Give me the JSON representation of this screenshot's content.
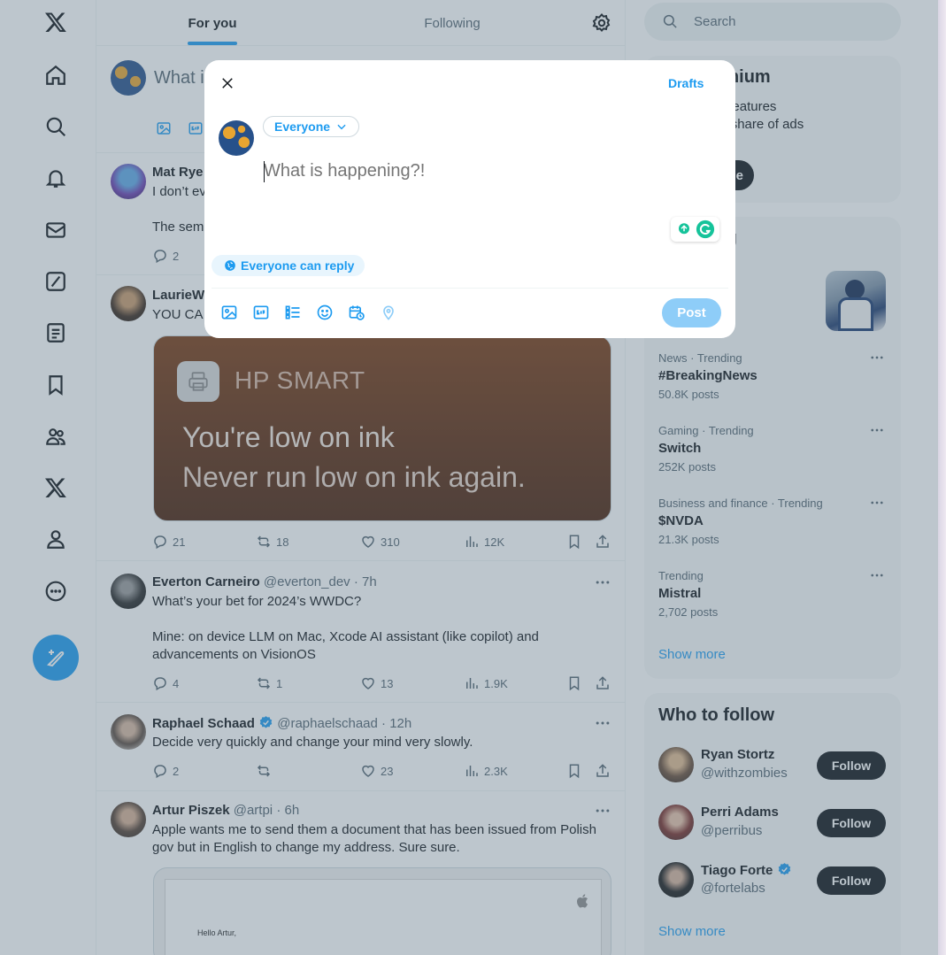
{
  "colors": {
    "brand": "#1d9bf0",
    "text": "#0f1419",
    "secondary_text": "#536471",
    "overlay": "rgba(91,112,131,0.4)",
    "post_disabled": "#8ecdf8"
  },
  "nav": {
    "items": [
      {
        "icon": "x-logo-icon"
      },
      {
        "icon": "home-icon"
      },
      {
        "icon": "search-icon"
      },
      {
        "icon": "bell-icon"
      },
      {
        "icon": "mail-icon"
      },
      {
        "icon": "grok-icon"
      },
      {
        "icon": "lists-icon"
      },
      {
        "icon": "bookmark-icon"
      },
      {
        "icon": "communities-icon"
      },
      {
        "icon": "premium-x-icon"
      },
      {
        "icon": "profile-icon"
      },
      {
        "icon": "more-circle-icon"
      }
    ],
    "compose_icon": "feather-plus-icon"
  },
  "feed": {
    "tabs": [
      {
        "label": "For you",
        "active": true
      },
      {
        "label": "Following",
        "active": false
      }
    ],
    "inline_composer_placeholder": "What i",
    "tweets": [
      {
        "name": "Mat Rye",
        "handle": "",
        "time": "",
        "text": "I don’t ev\n\nThe sem",
        "replies": "2"
      },
      {
        "name": "LaurieW",
        "handle": "",
        "time": "",
        "text": "YOU CA",
        "image": {
          "brand": "HP SMART",
          "line1": "You're low on ink",
          "line2": "Never run low on ink again."
        },
        "replies": "21",
        "reposts": "18",
        "likes": "310",
        "views": "12K"
      },
      {
        "name": "Everton Carneiro",
        "handle": "@everton_dev",
        "time": "· 7h",
        "text": "What’s your bet for 2024’s WWDC?\n\nMine: on device LLM on Mac, Xcode AI assistant (like copilot) and advancements on VisionOS",
        "replies": "4",
        "reposts": "1",
        "likes": "13",
        "views": "1.9K"
      },
      {
        "name": "Raphael Schaad",
        "handle": "@raphaelschaad",
        "time": "· 12h",
        "verified": true,
        "text": "Decide very quickly and change your mind very slowly.",
        "replies": "2",
        "reposts": "",
        "likes": "23",
        "views": "2.3K"
      },
      {
        "name": "Artur Piszek",
        "handle": "@artpi",
        "time": "· 6h",
        "text": "Apple wants me to send them a document that has been issued from Polish gov but in English to change my address. Sure sure.",
        "image": {
          "letter_greeting": "Hello Artur,"
        }
      }
    ]
  },
  "right": {
    "search_placeholder": "Search",
    "premium": {
      "title": "e to Premium",
      "text_line1": "unlock new features",
      "text_line2": "e, receive a share of ads",
      "button": "e"
    },
    "happening": {
      "title": "appening",
      "first_meta": "nt",
      "trends": [
        {
          "meta": "News · Trending",
          "name": "#BreakingNews",
          "count": "50.8K posts"
        },
        {
          "meta": "Gaming · Trending",
          "name": "Switch",
          "count": "252K posts"
        },
        {
          "meta": "Business and finance · Trending",
          "name": "$NVDA",
          "count": "21.3K posts"
        },
        {
          "meta": "Trending",
          "name": "Mistral",
          "count": "2,702 posts"
        }
      ],
      "show_more": "Show more"
    },
    "who_to_follow": {
      "title": "Who to follow",
      "users": [
        {
          "name": "Ryan Stortz",
          "handle": "@withzombies",
          "verified": false,
          "button": "Follow"
        },
        {
          "name": "Perri Adams",
          "handle": "@perribus",
          "verified": false,
          "button": "Follow"
        },
        {
          "name": "Tiago Forte",
          "handle": "@fortelabs",
          "verified": true,
          "button": "Follow"
        }
      ],
      "show_more": "Show more"
    }
  },
  "modal": {
    "drafts_label": "Drafts",
    "audience_label": "Everyone",
    "placeholder": "What is happening?!",
    "reply_setting": "Everyone can reply",
    "post_label": "Post",
    "tools": [
      "image-icon",
      "gif-icon",
      "poll-icon",
      "emoji-icon",
      "schedule-icon",
      "location-icon"
    ]
  }
}
